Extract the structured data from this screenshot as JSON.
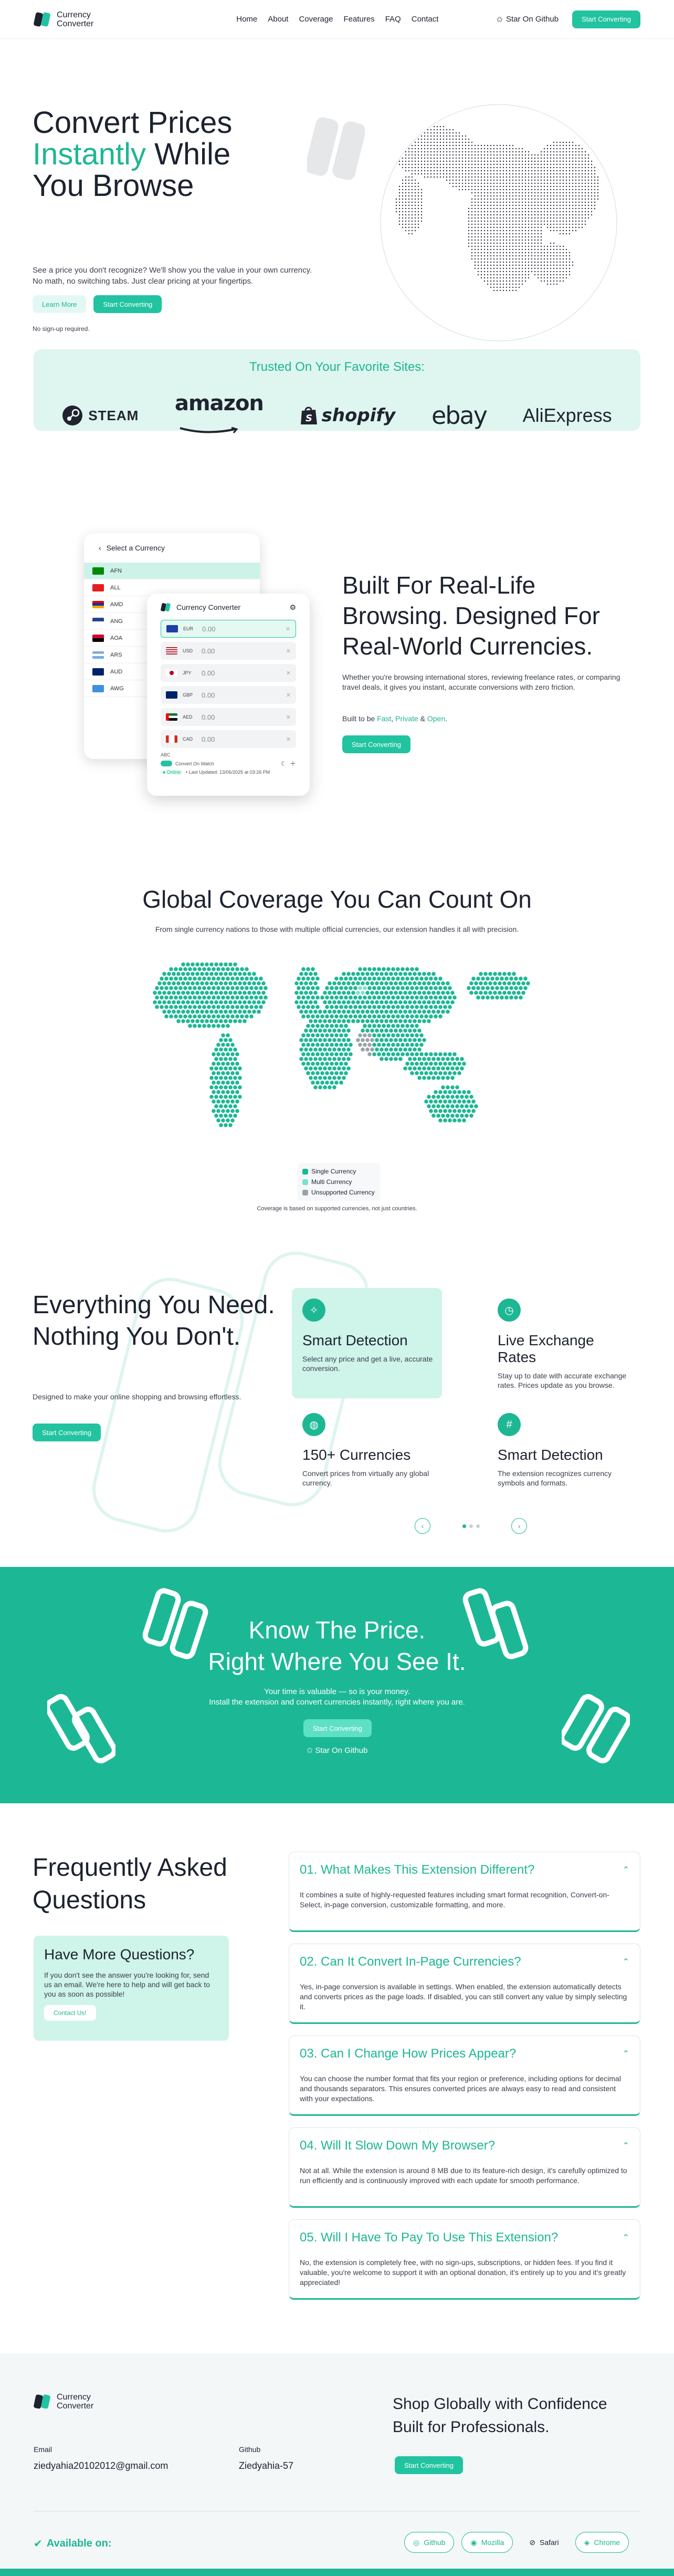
{
  "brand": {
    "name_line1": "Currency",
    "name_line2": "Converter"
  },
  "nav": {
    "links": [
      "Home",
      "About",
      "Coverage",
      "Features",
      "FAQ",
      "Contact"
    ],
    "star": "Star On Github",
    "cta": "Start Converting"
  },
  "hero": {
    "title_line1": "Convert Prices",
    "title_accent": "Instantly",
    "title_line2": " While",
    "title_line3": "You Browse",
    "sub1": "See a price you don't recognize? We'll show you the value in your own currency.",
    "sub2": "No math, no switching tabs. Just clear pricing at your fingertips.",
    "learn_btn": "Learn More",
    "start_btn": "Start Converting",
    "note": "No sign-up required."
  },
  "trusted": {
    "title": "Trusted On Your Favorite Sites:",
    "brands": [
      "STEAM",
      "amazon",
      "shopify",
      "ebay",
      "AliExpress"
    ]
  },
  "mock": {
    "back_title": "Select a Currency",
    "back_rows": [
      "AFN",
      "ALL",
      "AMD",
      "ANG",
      "AOA",
      "ARS",
      "AUD",
      "AWG"
    ],
    "front_title": "Currency Converter",
    "rows": [
      {
        "code": "EUR",
        "val": "0.00",
        "color": "#1e3fa8"
      },
      {
        "code": "USD",
        "val": "0.00",
        "color": "#b22234"
      },
      {
        "code": "JPY",
        "val": "0.00",
        "color": "#ffffff"
      },
      {
        "code": "GBP",
        "val": "0.00",
        "color": "#012169"
      },
      {
        "code": "AED",
        "val": "0.00",
        "color": "#00732f"
      },
      {
        "code": "CAD",
        "val": "0.00",
        "color": "#d52b1e"
      }
    ],
    "abc": "ABC",
    "convert": "Convert On Watch",
    "online": "● Online",
    "updated": "• Last Updated: 13/06/2025 at 03:26 PM"
  },
  "s2": {
    "title": "Built For Real-Life Browsing. Designed For Real-World Currencies.",
    "para": "Whether you're browsing international stores, reviewing freelance rates, or comparing travel deals, it gives you instant, accurate conversions with zero friction.",
    "built_prefix": "Built to be ",
    "fast": "Fast",
    "private": "Private",
    "amp": " & ",
    "open": "Open",
    "comma": ", ",
    "dot": ".",
    "btn": "Start Converting"
  },
  "coverage": {
    "title": "Global Coverage You Can Count On",
    "sub": "From single currency nations to those with multiple official currencies, our extension handles it all with precision.",
    "legend": [
      {
        "label": "Single Currency",
        "color": "#1db794"
      },
      {
        "label": "Multi Currency",
        "color": "#7fe0c9"
      },
      {
        "label": "Unsupported Currency",
        "color": "#9aa3a7"
      }
    ],
    "note": "Coverage is based on supported currencies, not just countries."
  },
  "features": {
    "title": "Everything You Need. Nothing You Don't.",
    "para": "Designed to make your online shopping and browsing effortless.",
    "btn": "Start Converting",
    "cards": [
      {
        "title": "Smart Detection",
        "desc": "Select any price and get a live, accurate conversion.",
        "icon": "sparkle-icon"
      },
      {
        "title": "Live Exchange Rates",
        "desc": "Stay up to date with accurate exchange rates. Prices update as you browse.",
        "icon": "clock-icon"
      },
      {
        "title": "150+ Currencies",
        "desc": "Convert prices from virtually any global currency.",
        "icon": "globe-icon"
      },
      {
        "title": "Smart Detection",
        "desc": "The extension recognizes currency symbols and formats.",
        "icon": "hash-icon"
      }
    ]
  },
  "cta": {
    "line1": "Know The Price.",
    "line2": "Right Where You See It.",
    "p1": "Your time is valuable — so is your money.",
    "p2": "Install the extension and convert currencies instantly, right where you are.",
    "btn": "Start Converting",
    "star": "Star On Github"
  },
  "faq": {
    "title": "Frequently Asked Questions",
    "more_title": "Have More Questions?",
    "more_text": "If you don't see the answer you're looking for, send us an email. We're here to help and will get back to you as soon as possible!",
    "more_btn": "Contact Us!",
    "items": [
      {
        "q": "01.  What Makes This Extension Different?",
        "a": "It combines a suite of highly-requested features including smart format recognition, Convert-on-Select, in-page conversion, customizable formatting, and more."
      },
      {
        "q": "02.  Can It Convert In-Page Currencies?",
        "a": "Yes, in-page conversion is available in settings. When enabled, the extension automatically detects and converts prices as the page loads. If disabled, you can still convert any value by simply selecting it."
      },
      {
        "q": "03.  Can I Change How Prices Appear?",
        "a": "You can choose the number format that fits your region or preference, including options for decimal and thousands separators. This ensures converted prices are always easy to read and consistent with your expectations."
      },
      {
        "q": "04.  Will It Slow Down My Browser?",
        "a": "Not at all. While the extension is around 8 MB due to its feature-rich design, it's carefully optimized to run efficiently and is continuously improved with each update for smooth performance."
      },
      {
        "q": "05.  Will I Have To Pay To Use This Extension?",
        "a": "No, the extension is completely free, with no sign-ups, subscriptions, or hidden fees. If you find it valuable, you're welcome to support it with an optional donation, it's entirely up to you and it's greatly appreciated!"
      }
    ]
  },
  "footer": {
    "email_label": "Email",
    "email": "ziedyahia20102012@gmail.com",
    "github_label": "Github",
    "github": "Ziedyahia-57",
    "headline": "Shop Globally with Confidence Built for Professionals.",
    "btn": "Start Converting",
    "available": "Available on:",
    "browsers": [
      "Github",
      "Mozilla",
      "Safari",
      "Chrome"
    ]
  }
}
